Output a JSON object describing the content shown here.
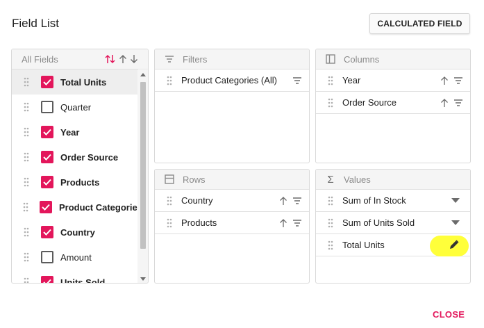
{
  "dialog": {
    "title": "Field List",
    "calculated_field_label": "CALCULATED FIELD",
    "close_label": "CLOSE"
  },
  "field_list": {
    "header": "All Fields",
    "fields": [
      {
        "label": "Total Units",
        "checked": true,
        "selected": true
      },
      {
        "label": "Quarter",
        "checked": false,
        "selected": false
      },
      {
        "label": "Year",
        "checked": true,
        "selected": false
      },
      {
        "label": "Order Source",
        "checked": true,
        "selected": false
      },
      {
        "label": "Products",
        "checked": true,
        "selected": false
      },
      {
        "label": "Product Categories",
        "checked": true,
        "selected": false
      },
      {
        "label": "Country",
        "checked": true,
        "selected": false
      },
      {
        "label": "Amount",
        "checked": false,
        "selected": false
      },
      {
        "label": "Units Sold",
        "checked": true,
        "selected": false
      }
    ]
  },
  "filters": {
    "header": "Filters",
    "items": [
      {
        "label": "Product Categories (All)"
      }
    ]
  },
  "columns": {
    "header": "Columns",
    "items": [
      {
        "label": "Year"
      },
      {
        "label": "Order Source"
      }
    ]
  },
  "rows": {
    "header": "Rows",
    "items": [
      {
        "label": "Country"
      },
      {
        "label": "Products"
      }
    ]
  },
  "values": {
    "header": "Values",
    "items": [
      {
        "label": "Sum of In Stock"
      },
      {
        "label": "Sum of Units Sold"
      },
      {
        "label": "Total Units"
      }
    ]
  },
  "colors": {
    "accent": "#e3165b",
    "highlight": "#ffff3a",
    "header_bg": "#f5f5f5",
    "border": "#d9d9d9"
  }
}
